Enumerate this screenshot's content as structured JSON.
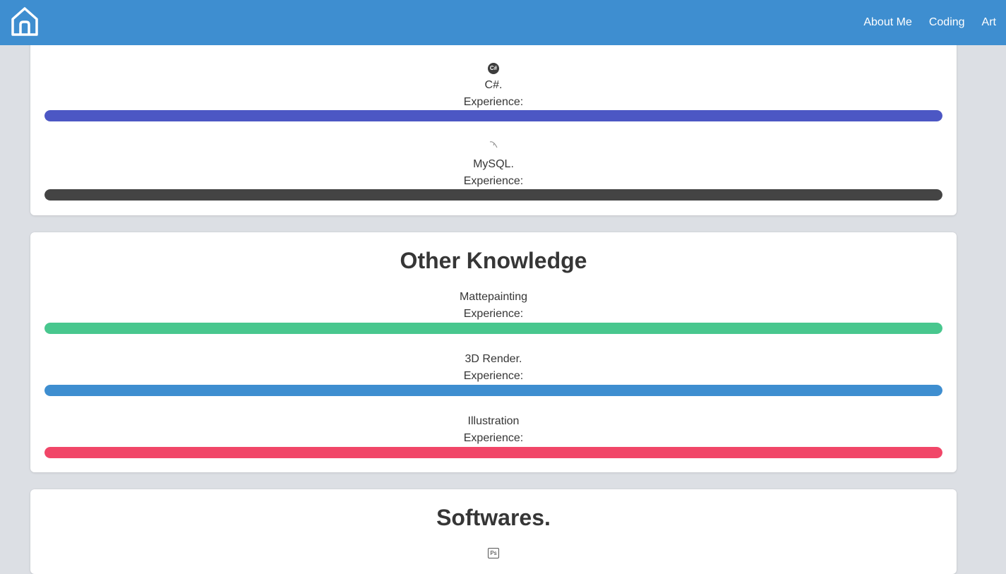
{
  "navbar": {
    "links": [
      "About Me",
      "Coding",
      "Art"
    ]
  },
  "programming": {
    "skills": [
      {
        "name": "C#.",
        "experience_label": "Experience:",
        "icon": "csharp-icon",
        "icon_text": "C#",
        "color": "#4c57c4",
        "level": 1.0
      },
      {
        "name": "MySQL.",
        "experience_label": "Experience:",
        "icon": "mysql-dolphin-icon",
        "color": "#444444",
        "level": 1.0
      }
    ]
  },
  "other_knowledge": {
    "title": "Other Knowledge",
    "skills": [
      {
        "name": "Mattepainting",
        "experience_label": "Experience:",
        "color": "#48c78e",
        "level": 1.0
      },
      {
        "name": "3D Render.",
        "experience_label": "Experience:",
        "color": "#3e8ed0",
        "level": 1.0
      },
      {
        "name": "Illustration",
        "experience_label": "Experience:",
        "color": "#f14668",
        "level": 1.0
      }
    ]
  },
  "softwares": {
    "title": "Softwares.",
    "first_icon": "photoshop-icon",
    "first_icon_text": "Ps"
  },
  "colors": {
    "navbar": "#3e8ed0",
    "background": "#dcdfe4"
  }
}
